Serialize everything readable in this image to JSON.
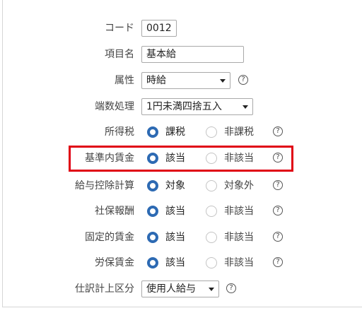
{
  "fields": {
    "code": {
      "label": "コード",
      "value": "0012"
    },
    "item_name": {
      "label": "項目名",
      "value": "基本給"
    },
    "attribute": {
      "label": "属性",
      "selected": "時給"
    },
    "rounding": {
      "label": "端数処理",
      "selected": "1円未満四捨五入"
    },
    "income_tax": {
      "label": "所得税",
      "options": [
        "課税",
        "非課税"
      ],
      "selected": "課税"
    },
    "base_wage": {
      "label": "基準内賃金",
      "options": [
        "該当",
        "非該当"
      ],
      "selected": "該当"
    },
    "deduction_calc": {
      "label": "給与控除計算",
      "options": [
        "対象",
        "対象外"
      ],
      "selected": "対象"
    },
    "social_insurance": {
      "label": "社保報酬",
      "options": [
        "該当",
        "非該当"
      ],
      "selected": "該当"
    },
    "fixed_wage": {
      "label": "固定的賃金",
      "options": [
        "該当",
        "非該当"
      ],
      "selected": "該当"
    },
    "labor_insurance": {
      "label": "労保賃金",
      "options": [
        "該当",
        "非該当"
      ],
      "selected": "該当"
    },
    "account_category": {
      "label": "仕訳計上区分",
      "selected": "使用人給与"
    }
  },
  "help_icon": "?",
  "colors": {
    "radio_selected": "#2d6ab3",
    "highlight": "#e00013"
  }
}
